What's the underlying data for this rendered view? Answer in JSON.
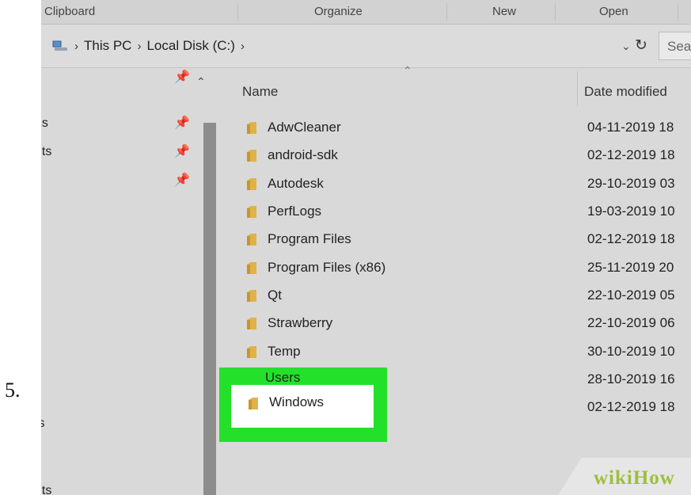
{
  "step_number": "5.",
  "ribbon": {
    "groups": [
      {
        "label": "Clipboard"
      },
      {
        "label": "Organize"
      },
      {
        "label": "New"
      },
      {
        "label": "Open"
      }
    ]
  },
  "address_bar": {
    "crumbs": [
      {
        "label": "This PC"
      },
      {
        "label": "Local Disk (C:)"
      }
    ],
    "search_placeholder": "Search Local Disk (C:)"
  },
  "nav_pane": {
    "items": [
      {
        "label": "ds",
        "pinned": true
      },
      {
        "label": "nts",
        "pinned": true
      },
      {
        "label": "",
        "pinned": true
      },
      {
        "label": "ts",
        "pinned": false
      },
      {
        "label": "nts",
        "pinned": false
      }
    ]
  },
  "file_list": {
    "columns": {
      "name": "Name",
      "date_modified": "Date modified"
    },
    "rows": [
      {
        "name": "AdwCleaner",
        "date": "04-11-2019 18"
      },
      {
        "name": "android-sdk",
        "date": "02-12-2019 18"
      },
      {
        "name": "Autodesk",
        "date": "29-10-2019 03"
      },
      {
        "name": "PerfLogs",
        "date": "19-03-2019 10"
      },
      {
        "name": "Program Files",
        "date": "02-12-2019 18"
      },
      {
        "name": "Program Files (x86)",
        "date": "25-11-2019 20"
      },
      {
        "name": "Qt",
        "date": "22-10-2019 05"
      },
      {
        "name": "Strawberry",
        "date": "22-10-2019 06"
      },
      {
        "name": "Temp",
        "date": "30-10-2019 10"
      },
      {
        "name": "Users",
        "date": "28-10-2019 16"
      },
      {
        "name": "Windows",
        "date": "02-12-2019 18"
      }
    ],
    "highlighted_folder": "Windows"
  },
  "watermark": {
    "part1": "wiki",
    "part2": "How"
  },
  "colors": {
    "highlight": "#23e02a",
    "folder": "#e0b24a",
    "window_bg": "#d9d9d9"
  }
}
